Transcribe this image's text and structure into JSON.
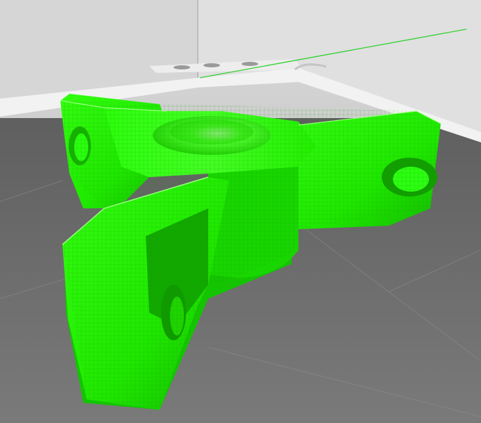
{
  "viewer": {
    "background_floor_color": "#6a6a6a",
    "back_wall_color": "#d8d8d8",
    "model_color": "#22ff00",
    "model_shadow_color": "#12b800",
    "highlight_color": "#e8ffe0",
    "axis_line_color": "#2fd12f",
    "grid_line_color": "#8f8f8f",
    "model_icon": "tri-arm-bracket-icon"
  }
}
